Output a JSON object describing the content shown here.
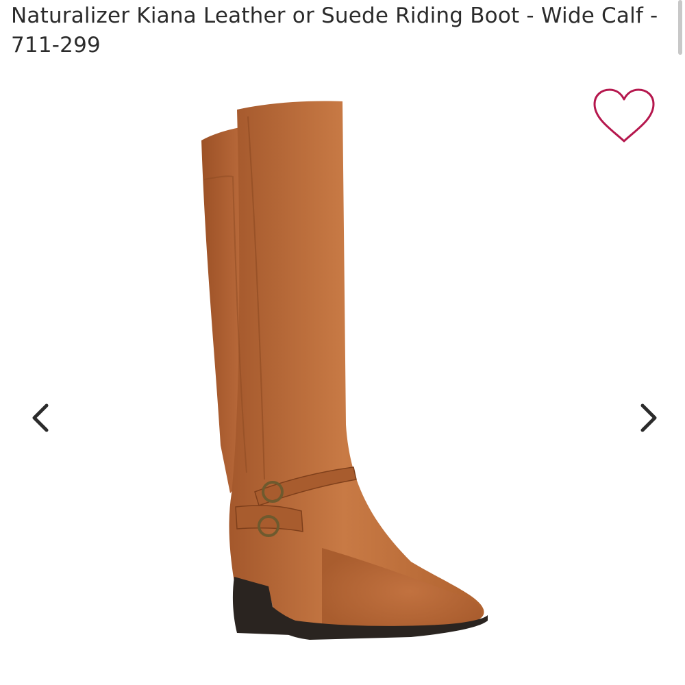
{
  "product": {
    "title": "Naturalizer Kiana Leather or Suede Riding Boot - Wide Calf  - 711-299"
  },
  "icons": {
    "favorite": "heart-outline-icon",
    "previous": "chevron-left-icon",
    "next": "chevron-right-icon"
  },
  "colors": {
    "favorite_accent": "#b5174d",
    "text": "#2b2b2b",
    "boot_leather": "#b8693a",
    "boot_heel": "#2a2420"
  }
}
